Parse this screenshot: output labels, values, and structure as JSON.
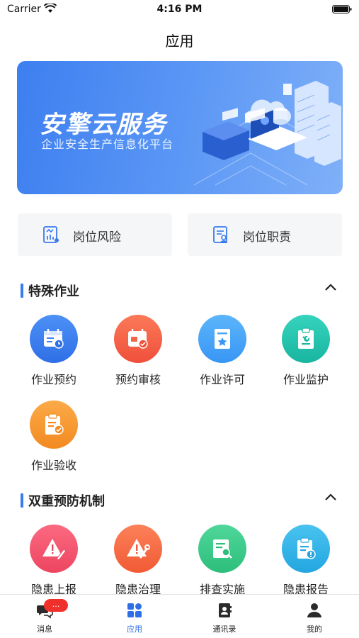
{
  "status_bar": {
    "carrier": "Carrier",
    "time": "4:16 PM"
  },
  "nav": {
    "title": "应用"
  },
  "banner": {
    "title": "安擎云服务",
    "subtitle": "企业安全生产信息化平台"
  },
  "quick_links": [
    {
      "label": "岗位风险",
      "icon": "risk-chart-icon"
    },
    {
      "label": "岗位职责",
      "icon": "duty-doc-icon"
    }
  ],
  "sections": [
    {
      "title": "特殊作业",
      "items": [
        {
          "label": "作业预约",
          "icon": "calendar-clock-icon",
          "color": "#3f82f2"
        },
        {
          "label": "预约审核",
          "icon": "calendar-check-icon",
          "color": "#f36547"
        },
        {
          "label": "作业许可",
          "icon": "permit-star-icon",
          "color": "#4aa6f7"
        },
        {
          "label": "作业监护",
          "icon": "clipboard-wrench-icon",
          "color": "#27c4ae"
        },
        {
          "label": "作业验收",
          "icon": "clipboard-check-icon",
          "color": "#f49b33"
        }
      ]
    },
    {
      "title": "双重预防机制",
      "items": [
        {
          "label": "隐患上报",
          "icon": "warning-pen-icon",
          "color": "#f05870"
        },
        {
          "label": "隐患治理",
          "icon": "warning-tool-icon",
          "color": "#f46b45"
        },
        {
          "label": "排查实施",
          "icon": "doc-search-icon",
          "color": "#3ccb8a"
        },
        {
          "label": "隐患报告",
          "icon": "report-alert-icon",
          "color": "#36b6ea"
        }
      ]
    }
  ],
  "tab_bar": {
    "items": [
      {
        "label": "消息",
        "icon": "chat-icon",
        "badge": "..."
      },
      {
        "label": "应用",
        "icon": "apps-grid-icon",
        "active": true
      },
      {
        "label": "通讯录",
        "icon": "contacts-icon"
      },
      {
        "label": "我的",
        "icon": "person-icon"
      }
    ],
    "active_color": "#2f6fe6"
  }
}
